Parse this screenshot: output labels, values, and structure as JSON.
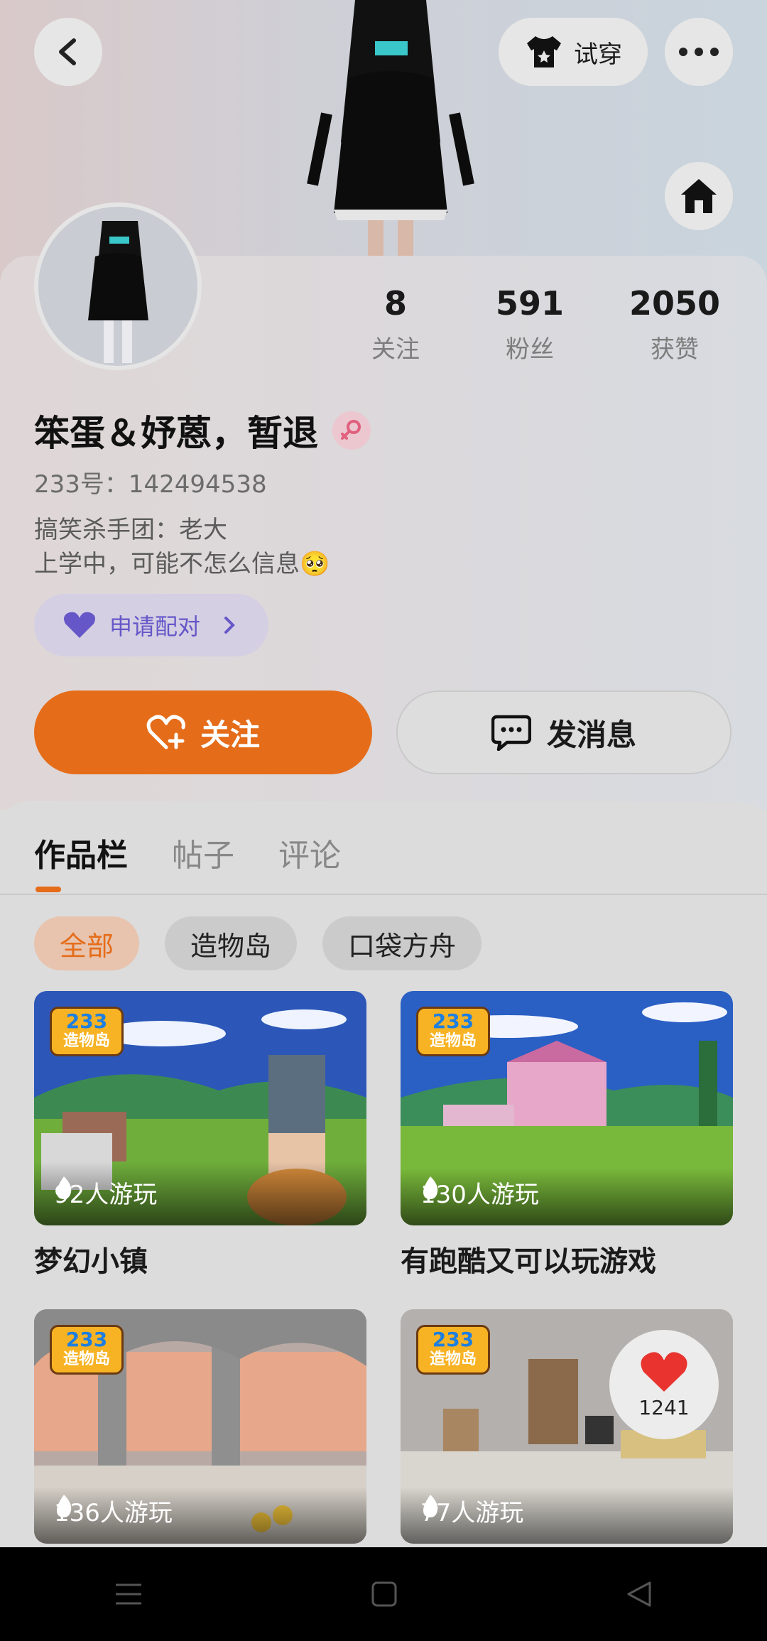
{
  "header": {
    "try_on_label": "试穿",
    "icons": [
      "back-arrow-icon",
      "tshirt-icon",
      "more-icon",
      "home-icon"
    ]
  },
  "profile": {
    "name": "笨蛋＆妤蒽，暂退",
    "uid": "233号：142494538",
    "bio_line1": "搞笑杀手团：老大",
    "bio_line2": "上学中，可能不怎么信息🥺",
    "pair_label": "申请配对",
    "stats": [
      {
        "value": "8",
        "label": "关注"
      },
      {
        "value": "591",
        "label": "粉丝"
      },
      {
        "value": "2050",
        "label": "获赞"
      }
    ],
    "follow_label": "关注",
    "message_label": "发消息"
  },
  "tabs": [
    {
      "label": "作品栏",
      "active": true
    },
    {
      "label": "帖子",
      "active": false
    },
    {
      "label": "评论",
      "active": false
    }
  ],
  "filters": [
    {
      "label": "全部",
      "active": true
    },
    {
      "label": "造物岛",
      "active": false
    },
    {
      "label": "口袋方舟",
      "active": false
    }
  ],
  "badge": {
    "line1": "233",
    "line2": "造物岛"
  },
  "works": [
    {
      "title": "梦幻小镇",
      "plays": "92人游玩"
    },
    {
      "title": "有跑酷又可以玩游戏",
      "plays": "130人游玩"
    },
    {
      "title": "",
      "plays": "136人游玩"
    },
    {
      "title": "",
      "plays": "77人游玩"
    }
  ],
  "like_bubble": {
    "count": "1241"
  },
  "colors": {
    "accent": "#e56c19",
    "pair": "#6657c8"
  }
}
